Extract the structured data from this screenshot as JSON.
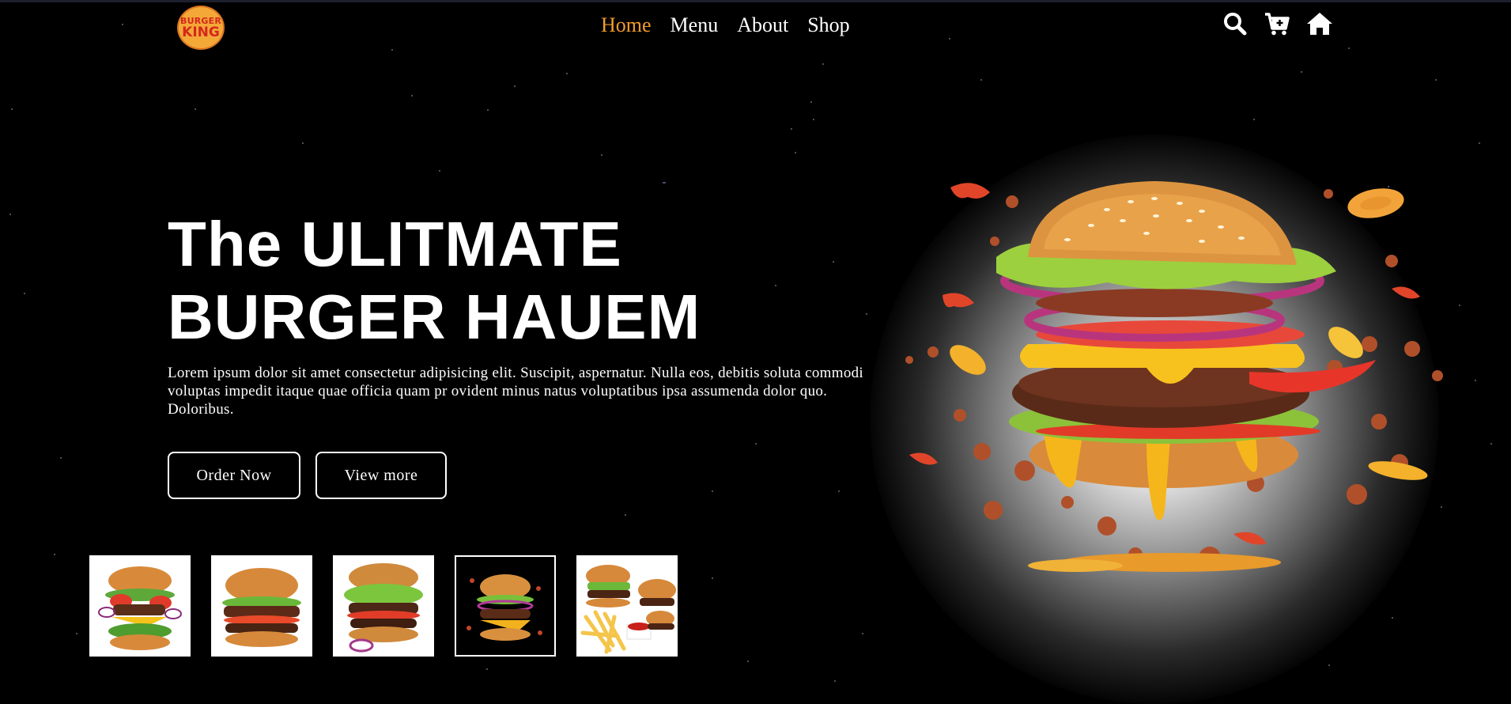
{
  "brand": {
    "logo_line1": "BURGER",
    "logo_line2": "KING"
  },
  "nav": {
    "items": [
      "Home",
      "Menu",
      "About",
      "Shop"
    ],
    "active": "Home"
  },
  "header_icons": [
    "search-icon",
    "cart-icon",
    "home-icon"
  ],
  "hero": {
    "headline_line1": "The ULITMATE",
    "headline_line2": "BURGER HAUEM",
    "description": "Lorem ipsum dolor sit amet consectetur adipisicing elit. Suscipit, aspernatur. Nulla eos, debitis soluta commodi voluptas impedit itaque quae officia quam pr ovident minus natus voluptatibus ipsa assumenda dolor quo. Doloribus.",
    "primary_button": "Order Now",
    "secondary_button": "View more"
  },
  "thumbnails": [
    "burger-thumbnail-1",
    "burger-thumbnail-2",
    "burger-thumbnail-3",
    "burger-thumbnail-4",
    "burger-fries-thumbnail-5"
  ],
  "colors": {
    "background": "#000000",
    "accent": "#f39c2b",
    "text": "#ffffff"
  }
}
